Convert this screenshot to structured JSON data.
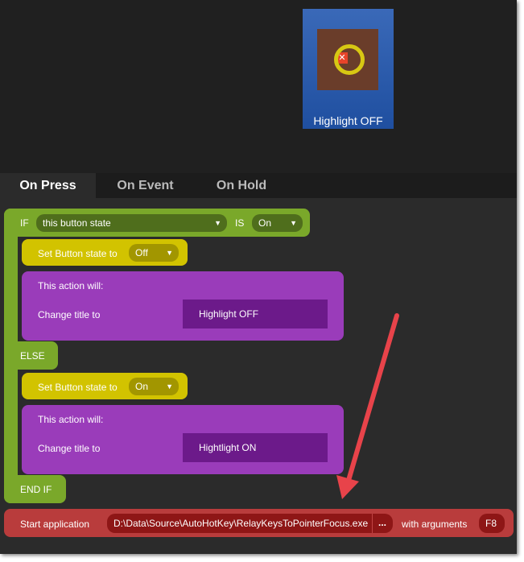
{
  "key": {
    "title": "Highlight OFF",
    "icon": "highlight-ring-icon"
  },
  "tabs": [
    {
      "label": "On Press",
      "active": true
    },
    {
      "label": "On Event"
    },
    {
      "label": "On Hold"
    }
  ],
  "if": {
    "label": "IF",
    "subject": "this button state",
    "is": "IS",
    "value": "On"
  },
  "then": {
    "set_label": "Set Button state to",
    "set_value": "Off",
    "action_will": "This action will:",
    "change_label": "Change title to",
    "title_value": "Highlight OFF"
  },
  "else": {
    "label": "ELSE",
    "set_label": "Set Button state to",
    "set_value": "On",
    "action_will": "This action will:",
    "change_label": "Change title to",
    "title_value": "Hightlight ON"
  },
  "endif": "END IF",
  "start": {
    "label": "Start application",
    "path": "D:\\Data\\Source\\AutoHotKey\\RelayKeysToPointerFocus.exe",
    "browse": "...",
    "with_args": "with arguments",
    "args": "F8"
  },
  "colors": {
    "if": "#7aa82a",
    "set": "#d2c300",
    "action": "#9a3cba",
    "start": "#b93c3c",
    "annotation_arrow": "#e8434a"
  }
}
